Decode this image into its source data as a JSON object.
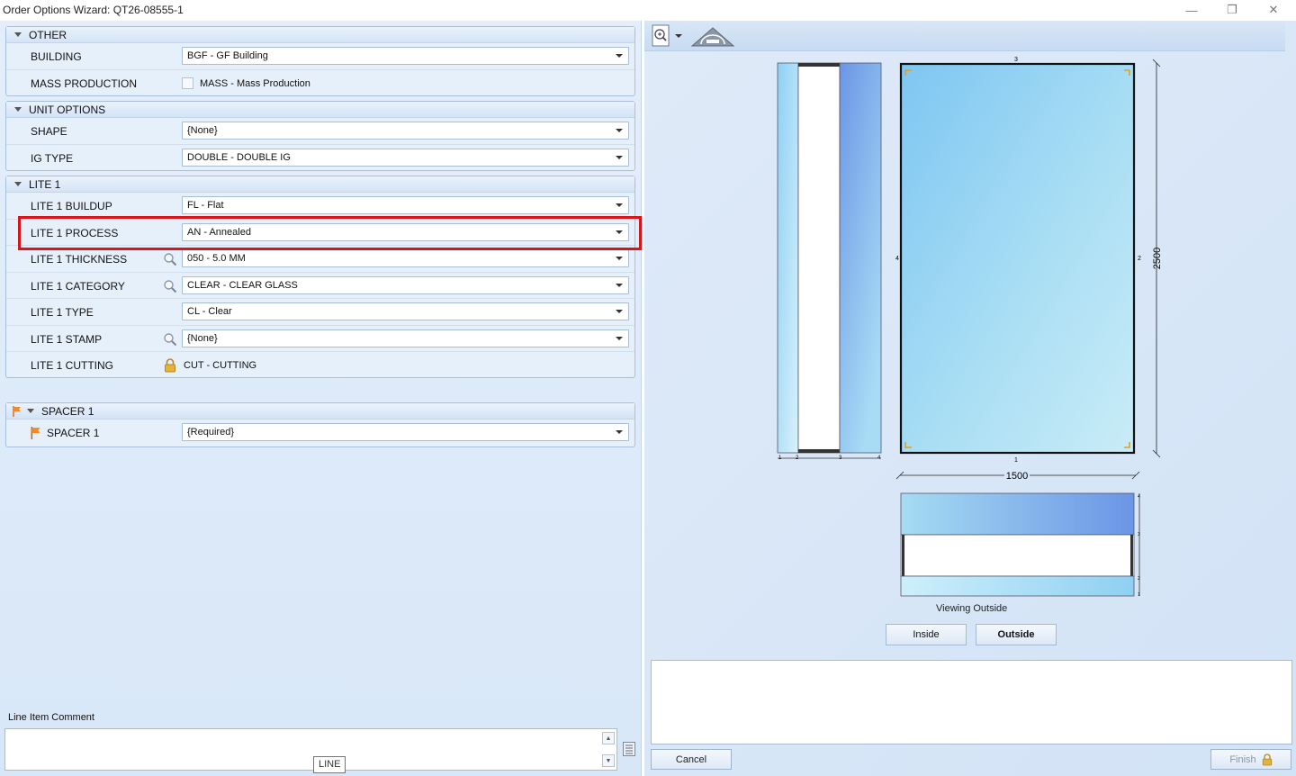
{
  "window": {
    "title": "Order Options Wizard: QT26-08555-1",
    "controls": {
      "minimize": "—",
      "restore": "❐",
      "close": "✕"
    }
  },
  "groups": {
    "other": {
      "header": "OTHER",
      "building": {
        "label": "BUILDING",
        "value": "BGF - GF Building"
      },
      "mass_production": {
        "label": "MASS PRODUCTION",
        "checkbox_label": "MASS - Mass Production",
        "checked": false
      }
    },
    "unit_options": {
      "header": "UNIT OPTIONS",
      "shape": {
        "label": "SHAPE",
        "value": "{None}"
      },
      "ig_type": {
        "label": "IG TYPE",
        "value": "DOUBLE - DOUBLE IG"
      }
    },
    "lite1": {
      "header": "LITE 1",
      "buildup": {
        "label": "LITE 1 BUILDUP",
        "value": "FL - Flat"
      },
      "process": {
        "label": "LITE 1 PROCESS",
        "value": "AN - Annealed"
      },
      "thickness": {
        "label": "LITE 1 THICKNESS",
        "value": "050 - 5.0 MM"
      },
      "category": {
        "label": "LITE 1 CATEGORY",
        "value": "CLEAR - CLEAR GLASS"
      },
      "type": {
        "label": "LITE 1 TYPE",
        "value": "CL - Clear"
      },
      "stamp": {
        "label": "LITE 1 STAMP",
        "value": "{None}"
      },
      "cutting": {
        "label": "LITE 1 CUTTING",
        "value": "CUT - CUTTING"
      }
    },
    "spacer1": {
      "header": "SPACER 1",
      "spacer": {
        "label": "SPACER 1",
        "value": "{Required}"
      }
    }
  },
  "comment": {
    "label": "Line Item Comment",
    "value": "",
    "tooltip": "LINE"
  },
  "preview": {
    "width_dim": "1500",
    "height_dim": "2500",
    "edge_labels": {
      "top": "3",
      "bottom": "1",
      "left": "4",
      "right": "2"
    },
    "section_labels": [
      "1",
      "2",
      "3",
      "4"
    ],
    "viewing_label": "Viewing Outside",
    "inside_button": "Inside",
    "outside_button": "Outside"
  },
  "actions": {
    "cancel": "Cancel",
    "finish": "Finish"
  },
  "colors": {
    "highlight": "#d9151b",
    "glass_light": "#a8dcf5",
    "glass_dark": "#6b95e6"
  }
}
